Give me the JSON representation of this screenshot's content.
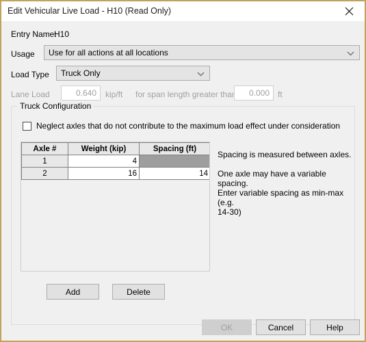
{
  "window": {
    "title": "Edit Vehicular Live Load - H10 (Read Only)",
    "close_icon": "close-icon",
    "border_color": "#bfa35a",
    "body_color": "#f0f0f0"
  },
  "form": {
    "entry_name_label": "Entry Name:",
    "entry_name_value": "H10",
    "usage_label": "Usage",
    "usage_value": "Use for all actions at all locations",
    "load_type_label": "Load Type",
    "load_type_value": "Truck Only",
    "lane_load_label": "Lane Load",
    "lane_load_value": "0.640",
    "lane_load_units": "kip/ft",
    "span_length_label": "for span length greater than",
    "span_length_value": "0.000",
    "span_length_units": "ft"
  },
  "truck_configuration": {
    "group_title": "Truck Configuration",
    "neglect_checkbox_label": "Neglect axles that do not contribute to the maximum load effect under consideration",
    "neglect_checkbox_checked": false,
    "table": {
      "columns": [
        "Axle #",
        "Weight (kip)",
        "Spacing (ft)"
      ],
      "rows": [
        {
          "axle": "1",
          "weight": "4",
          "spacing": "",
          "spacing_blocked": true
        },
        {
          "axle": "2",
          "weight": "16",
          "spacing": "14",
          "spacing_blocked": false
        }
      ]
    },
    "note_line1": "Spacing is measured between axles.",
    "note_line2": "One axle may have a variable spacing.",
    "note_line3": "Enter variable spacing as min-max (e.g.",
    "note_line4": "14-30)",
    "add_label": "Add",
    "delete_label": "Delete"
  },
  "footer": {
    "ok_label": "OK",
    "ok_enabled": false,
    "cancel_label": "Cancel",
    "help_label": "Help"
  }
}
